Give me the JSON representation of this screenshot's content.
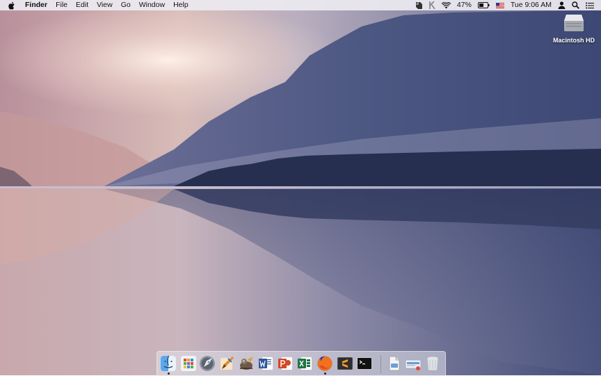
{
  "menubar": {
    "apple_icon": "apple-logo-icon",
    "app_name": "Finder",
    "menus": [
      "File",
      "Edit",
      "View",
      "Go",
      "Window",
      "Help"
    ],
    "status": {
      "battery_percent": "47%",
      "clock": "Tue 9:06 AM",
      "icons": [
        "evernote-icon",
        "k-icon",
        "wifi-icon",
        "battery-icon",
        "us-flag-icon",
        "user-icon",
        "spotlight-icon",
        "notification-center-icon"
      ]
    }
  },
  "desktop": {
    "drive_label": "Macintosh HD"
  },
  "dock": {
    "apps": [
      {
        "name": "Finder",
        "icon": "finder-icon",
        "running": true
      },
      {
        "name": "Launchpad",
        "icon": "launchpad-icon",
        "running": false
      },
      {
        "name": "Rocket",
        "icon": "rocket-icon",
        "running": false
      },
      {
        "name": "Sketch",
        "icon": "pencil-brush-icon",
        "running": false
      },
      {
        "name": "GIMP",
        "icon": "gimp-icon",
        "running": false
      },
      {
        "name": "Microsoft Word",
        "icon": "word-icon",
        "running": false
      },
      {
        "name": "Microsoft PowerPoint",
        "icon": "powerpoint-icon",
        "running": false
      },
      {
        "name": "Microsoft Excel",
        "icon": "excel-icon",
        "running": false
      },
      {
        "name": "Firefox",
        "icon": "firefox-icon",
        "running": true
      },
      {
        "name": "Sublime Text",
        "icon": "sublime-icon",
        "running": false
      },
      {
        "name": "Terminal",
        "icon": "terminal-icon",
        "running": false
      }
    ],
    "others": [
      {
        "name": "Preview",
        "icon": "preview-icon"
      },
      {
        "name": "Downloads",
        "icon": "downloads-icon"
      },
      {
        "name": "Trash",
        "icon": "trash-icon"
      }
    ]
  }
}
